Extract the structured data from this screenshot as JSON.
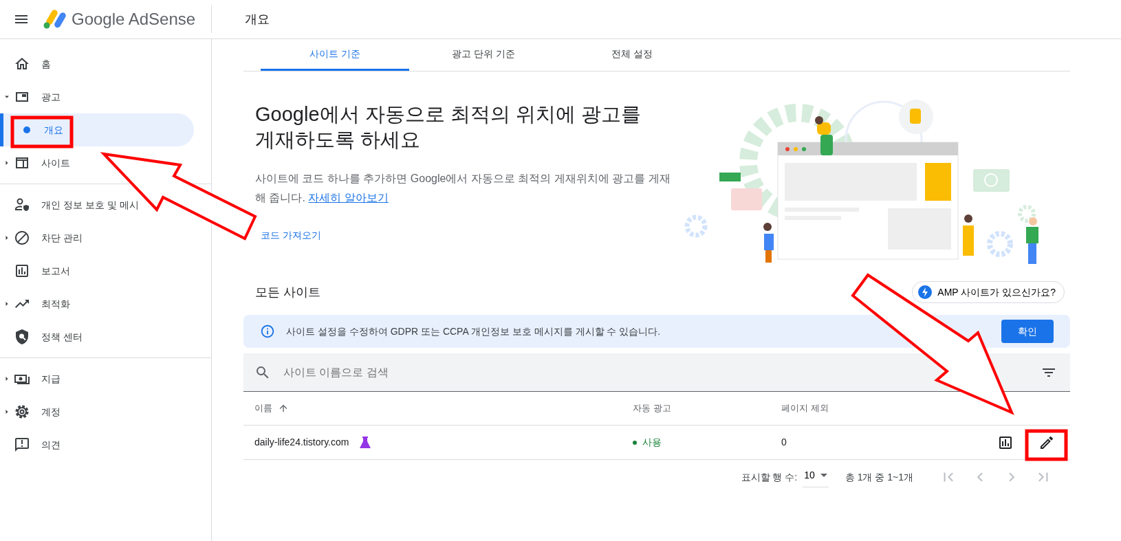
{
  "header": {
    "product": "Google AdSense",
    "page_title": "개요"
  },
  "sidebar": {
    "sections": [
      {
        "items": [
          {
            "label": "홈",
            "kind": "link",
            "selected": false
          },
          {
            "label": "광고",
            "kind": "expandable",
            "expanded": true,
            "selected": false,
            "children": [
              {
                "label": "개요",
                "kind": "child",
                "selected": true
              }
            ]
          },
          {
            "label": "사이트",
            "kind": "expandable",
            "expanded": false,
            "selected": false
          }
        ]
      },
      {
        "items": [
          {
            "label": "개인 정보 보호 및 메시",
            "kind": "link",
            "selected": false
          },
          {
            "label": "차단 관리",
            "kind": "expandable",
            "expanded": false,
            "selected": false
          },
          {
            "label": "보고서",
            "kind": "link",
            "selected": false
          },
          {
            "label": "최적화",
            "kind": "expandable",
            "expanded": false,
            "selected": false
          },
          {
            "label": "정책 센터",
            "kind": "link",
            "selected": false
          }
        ]
      },
      {
        "items": [
          {
            "label": "지급",
            "kind": "expandable",
            "expanded": false,
            "selected": false
          },
          {
            "label": "계정",
            "kind": "expandable",
            "expanded": false,
            "selected": false
          },
          {
            "label": "의견",
            "kind": "link",
            "selected": false
          }
        ]
      }
    ]
  },
  "tabs": [
    {
      "label": "사이트 기준",
      "selected": true
    },
    {
      "label": "광고 단위 기준",
      "selected": false
    },
    {
      "label": "전체 설정",
      "selected": false
    }
  ],
  "hero": {
    "headline": "Google에서 자동으로 최적의 위치에 광고를 게재하도록 하세요",
    "body": "사이트에 코드 하나를 추가하면 Google에서 자동으로 최적의 게재위치에 광고를 게재해 줍니다.",
    "link": "자세히 알아보기",
    "button": "코드 가져오기"
  },
  "sites": {
    "title": "모든 사이트",
    "amp_chip": "AMP 사이트가 있으신가요?",
    "banner": {
      "text": "사이트 설정을 수정하여 GDPR 또는 CCPA 개인정보 보호 메시지를 게시할 수 있습니다.",
      "button": "확인"
    },
    "search": {
      "placeholder": "사이트 이름으로 검색"
    },
    "table": {
      "columns": [
        "이름",
        "자동 광고",
        "페이지 제외"
      ],
      "rows": [
        {
          "name": "daily-life24.tistory.com",
          "experiment": true,
          "auto_ads": "사용",
          "auto_ads_on": true,
          "page_exclusions": "0"
        }
      ]
    },
    "pagination": {
      "rows_label": "표시할 행 수:",
      "rows_value": "10",
      "range": "총 1개 중 1~1개",
      "buttons": [
        {
          "kind": "first",
          "disabled": true
        },
        {
          "kind": "prev",
          "disabled": true
        },
        {
          "kind": "next",
          "disabled": true
        },
        {
          "kind": "last",
          "disabled": true
        }
      ]
    }
  }
}
